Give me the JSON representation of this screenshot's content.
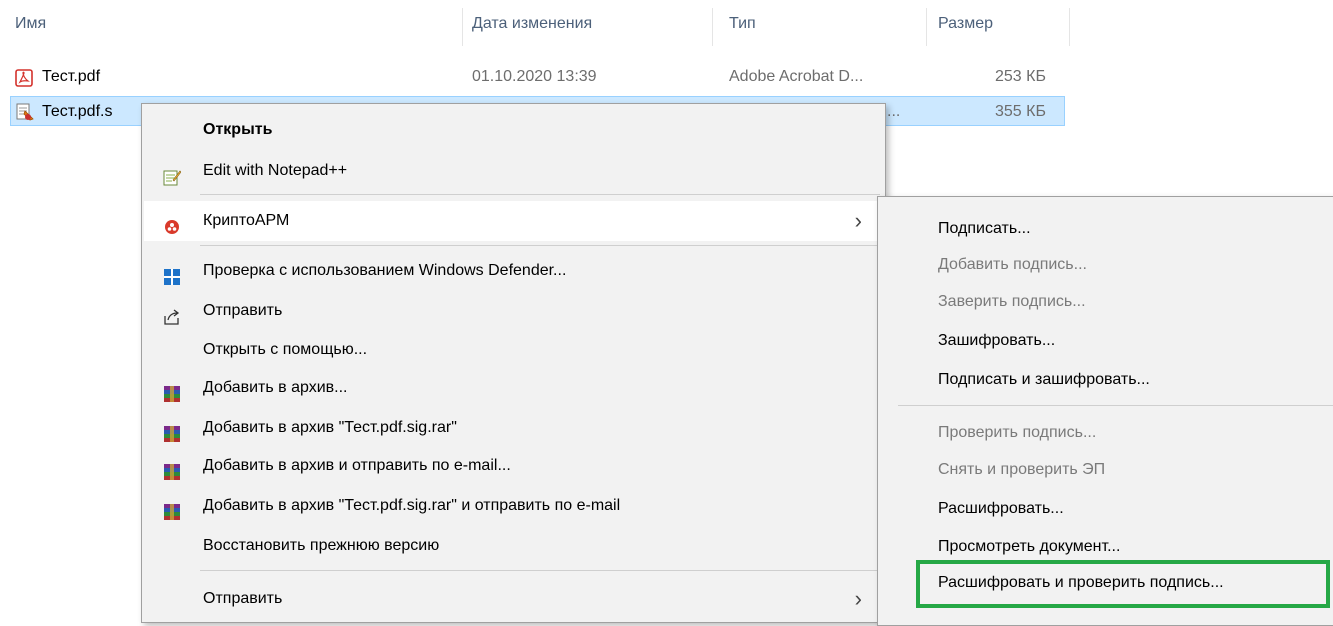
{
  "columns": {
    "name": "Имя",
    "date": "Дата изменения",
    "type": "Тип",
    "size": "Размер"
  },
  "files": [
    {
      "name": "Тест.pdf",
      "date": "01.10.2020 13:39",
      "type": "Adobe Acrobat D...",
      "size": "253 КБ",
      "icon": "pdf-icon",
      "selected": false
    },
    {
      "name": "Тест.pdf.s",
      "date": "",
      "type": "...",
      "size": "355 КБ",
      "icon": "signed-document-icon",
      "selected": true
    }
  ],
  "context_menu": {
    "items": [
      {
        "label": "Открыть",
        "bold": true
      },
      {
        "label": "Edit with Notepad++",
        "icon": "notepad-icon"
      },
      {
        "label": "КриптоАРМ",
        "icon": "cryptoarm-icon",
        "submenu": true
      },
      {
        "label": "Проверка с использованием Windows Defender...",
        "icon": "windows-defender-icon"
      },
      {
        "label": "Отправить",
        "icon": "share-icon"
      },
      {
        "label": "Открыть с помощью..."
      },
      {
        "label": "Добавить в архив...",
        "icon": "winrar-icon"
      },
      {
        "label": "Добавить в архив \"Тест.pdf.sig.rar\"",
        "icon": "winrar-icon"
      },
      {
        "label": "Добавить в архив и отправить по e-mail...",
        "icon": "winrar-icon"
      },
      {
        "label": "Добавить в архив \"Тест.pdf.sig.rar\" и отправить по e-mail",
        "icon": "winrar-icon"
      },
      {
        "label": "Восстановить прежнюю версию"
      },
      {
        "label": "Отправить",
        "submenu": true
      }
    ]
  },
  "submenu": {
    "items": [
      {
        "label": "Подписать...",
        "enabled": true
      },
      {
        "label": "Добавить подпись...",
        "enabled": false
      },
      {
        "label": "Заверить подпись...",
        "enabled": false
      },
      {
        "label": "Зашифровать...",
        "enabled": true
      },
      {
        "label": "Подписать и зашифровать...",
        "enabled": true
      },
      {
        "label": "Проверить подпись...",
        "enabled": false
      },
      {
        "label": "Снять и проверить ЭП",
        "enabled": false
      },
      {
        "label": "Расшифровать...",
        "enabled": true
      },
      {
        "label": "Просмотреть документ...",
        "enabled": true
      },
      {
        "label": "Расшифровать и проверить подпись...",
        "enabled": true,
        "highlighted": true
      }
    ]
  },
  "colors": {
    "selection": "#cce8ff",
    "highlight_box": "#26a846",
    "header_text": "#4c607a"
  }
}
